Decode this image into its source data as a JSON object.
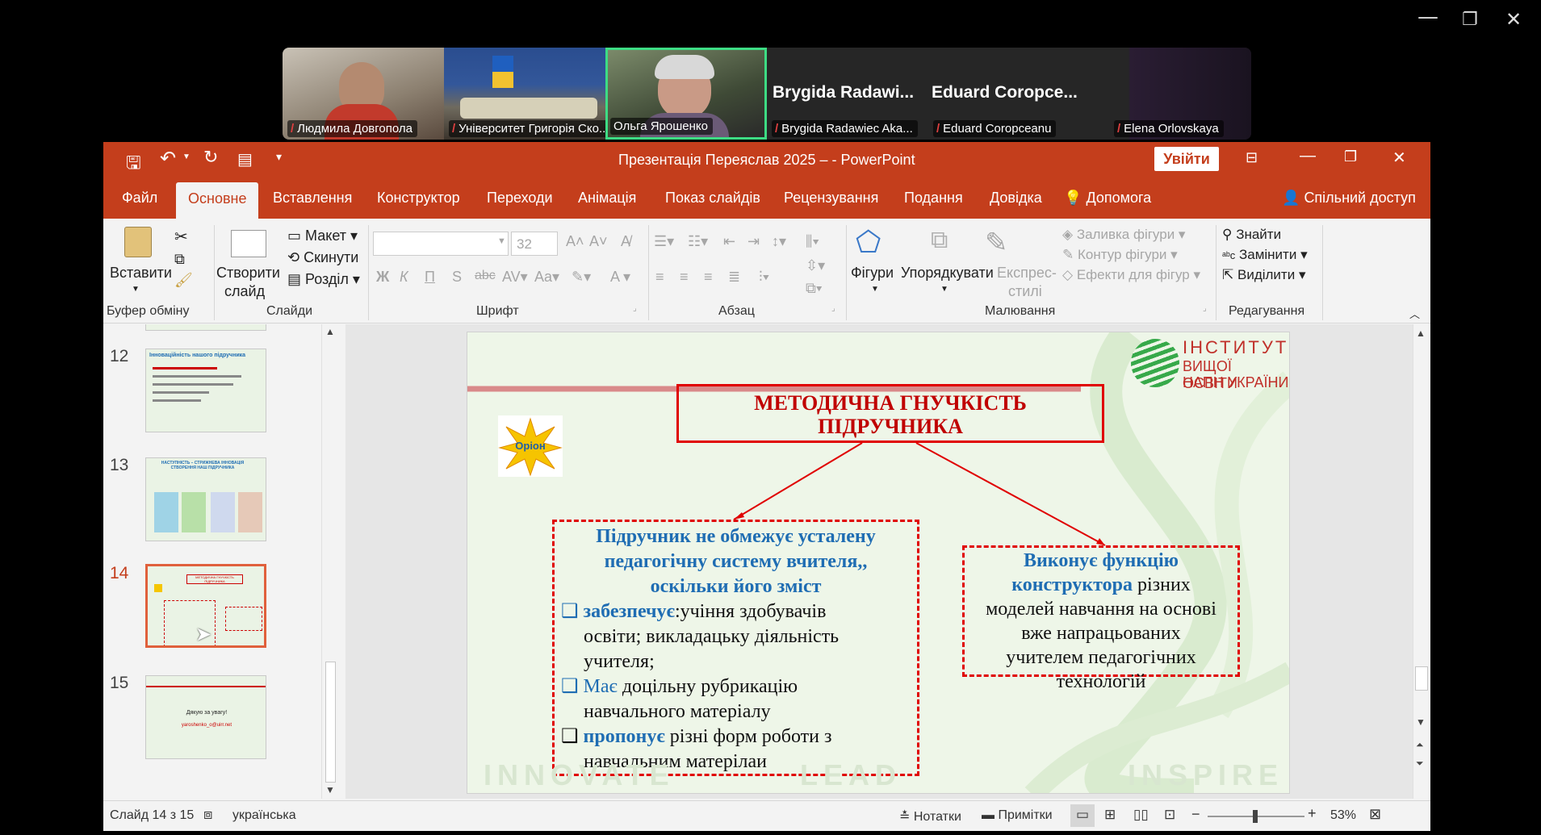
{
  "window_controls": {
    "minimize": "—",
    "restore": "❐",
    "close": "✕"
  },
  "meeting": {
    "participants": [
      {
        "name": "Людмила Довгопола"
      },
      {
        "name": "Університет Григорія Ско..."
      },
      {
        "name": "Ольга Ярошенко"
      },
      {
        "name": "Brygida Radawiec Aka...",
        "display": "Brygida  Radawi..."
      },
      {
        "name": "Eduard Coropceanu",
        "display": "Eduard  Coropce..."
      },
      {
        "name": "Elena Orlovskaya"
      }
    ]
  },
  "ppt": {
    "title": "Презентація Переяслав 2025 –  -  PowerPoint",
    "signin": "Увійти",
    "tabs": [
      "Файл",
      "Основне",
      "Вставлення",
      "Конструктор",
      "Переходи",
      "Анімація",
      "Показ слайдів",
      "Рецензування",
      "Подання",
      "Довідка",
      "Допомога"
    ],
    "share": "Спільний доступ",
    "ribbon": {
      "paste": "Вставити",
      "new_slide_1": "Створити",
      "new_slide_2": "слайд",
      "layout": "Макет",
      "reset": "Скинути",
      "section": "Розділ",
      "font_size": "32",
      "shapes": "Фігури",
      "arrange": "Упорядкувати",
      "quick_styles_1": "Експрес-",
      "quick_styles_2": "стилі",
      "shape_fill": "Заливка фігури",
      "shape_outline": "Контур фігури",
      "shape_effects": "Ефекти для фігур",
      "find": "Знайти",
      "replace": "Замінити",
      "select": "Виділити",
      "groups": {
        "clipboard": "Буфер обміну",
        "slides": "Слайди",
        "font": "Шрифт",
        "paragraph": "Абзац",
        "drawing": "Малювання",
        "editing": "Редагування"
      },
      "font_buttons": [
        "Ж",
        "К",
        "П",
        "S"
      ]
    },
    "thumbs": [
      {
        "num": "12",
        "title": "Інноваційність нашого підручника"
      },
      {
        "num": "13",
        "title": "НАСТУПНІСТЬ – СТРИЖНЕВА ІННОВАЦІЯ СТВОРЕННЯ НАШ ПІДРУЧНИКА"
      },
      {
        "num": "14",
        "title": "МЕТОДИЧНА ГНУЧКІСТЬ ПІДРУЧНИКА"
      },
      {
        "num": "15",
        "title": "Дякую за увагу!",
        "email": "yaroshenko_o@uirr.net"
      }
    ],
    "slide": {
      "logo_line1": "ІНСТИТУТ",
      "logo_line2": "ВИЩОЇ ОСВІТИ",
      "logo_line3": "НАПН УКРАЇНИ",
      "orion": "Оріон",
      "title_line1": "МЕТОДИЧНА ГНУЧКІСТЬ",
      "title_line2": "ПІДРУЧНИКА",
      "left_head_1": "Підручник не обмежує усталену",
      "left_head_2": "педагогічну систему вчителя,,",
      "left_head_3": "оскільки його зміст",
      "b1_key": "забезпечує",
      "b1_rest": ":учіння здобувачів",
      "b1_line2": "освіти; викладацьку діяльність",
      "b1_line3": "учителя;",
      "b2_key": "Має",
      "b2_rest": "  доцільну рубрикацію",
      "b2_line2": "навчального матеріалу",
      "b3_key": "пропонує",
      "b3_rest": " різні форм роботи з",
      "b3_line2": "навчальним матерілаи",
      "right_key_1": "Виконує функцію",
      "right_key_2": "конструктора",
      "right_rest": " різних",
      "right_line2": "моделей навчання на основі",
      "right_line3": "вже напрацьованих",
      "right_line4": "учителем педагогічних",
      "right_line5": "технологій",
      "watermark_1": "INNOVATE",
      "watermark_2": "LEAD",
      "watermark_3": "INSPIRE"
    },
    "status": {
      "slide_info": "Слайд 14 з 15",
      "language": "українська",
      "notes": "Нотатки",
      "comments": "Примітки",
      "zoom": "53%"
    }
  },
  "colors": {
    "accent": "#c43e1c",
    "slide_red": "#c00000",
    "slide_blue": "#1f6db3"
  }
}
